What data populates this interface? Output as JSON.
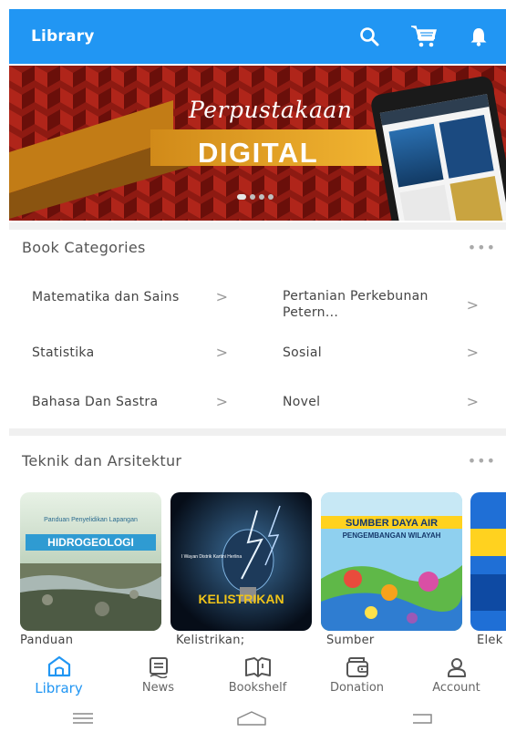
{
  "appbar": {
    "title": "Library",
    "accent": "#2196f3",
    "icons": [
      "search-icon",
      "cart-icon",
      "bell-icon"
    ]
  },
  "banner": {
    "script_title": "Perpustakaan",
    "headline": "DIGITAL",
    "slide_count": 4,
    "active_slide": 1
  },
  "categories": {
    "heading": "Book Categories",
    "more": "•••",
    "items": [
      {
        "label": "Matematika dan Sains"
      },
      {
        "label": "Pertanian Perkebunan Petern..."
      },
      {
        "label": "Statistika"
      },
      {
        "label": "Sosial"
      },
      {
        "label": "Bahasa Dan Sastra"
      },
      {
        "label": "Novel"
      }
    ],
    "chevron": ">"
  },
  "featured": {
    "heading": "Teknik dan Arsitektur",
    "more": "•••",
    "books": [
      {
        "title": "Panduan",
        "cover_title": "HIDROGEOLOGI",
        "cover_pre": "Panduan Penyelidikan Lapangan"
      },
      {
        "title": "Kelistrikan;",
        "cover_title": "KELISTRIKAN",
        "cover_pre": "I Wayan Distrik Kartini Herlina"
      },
      {
        "title": "Sumber",
        "cover_title": "SUMBER DAYA AIR",
        "cover_pre": "PENGEMBANGAN WILAYAH"
      },
      {
        "title": "Elek"
      }
    ]
  },
  "bottomnav": {
    "items": [
      {
        "label": "Library",
        "icon": "library-icon",
        "active": true
      },
      {
        "label": "News",
        "icon": "news-icon",
        "active": false
      },
      {
        "label": "Bookshelf",
        "icon": "bookshelf-icon",
        "active": false
      },
      {
        "label": "Donation",
        "icon": "wallet-icon",
        "active": false
      },
      {
        "label": "Account",
        "icon": "account-icon",
        "active": false
      }
    ]
  },
  "system_nav": [
    "menu-icon",
    "home-icon",
    "back-icon"
  ]
}
